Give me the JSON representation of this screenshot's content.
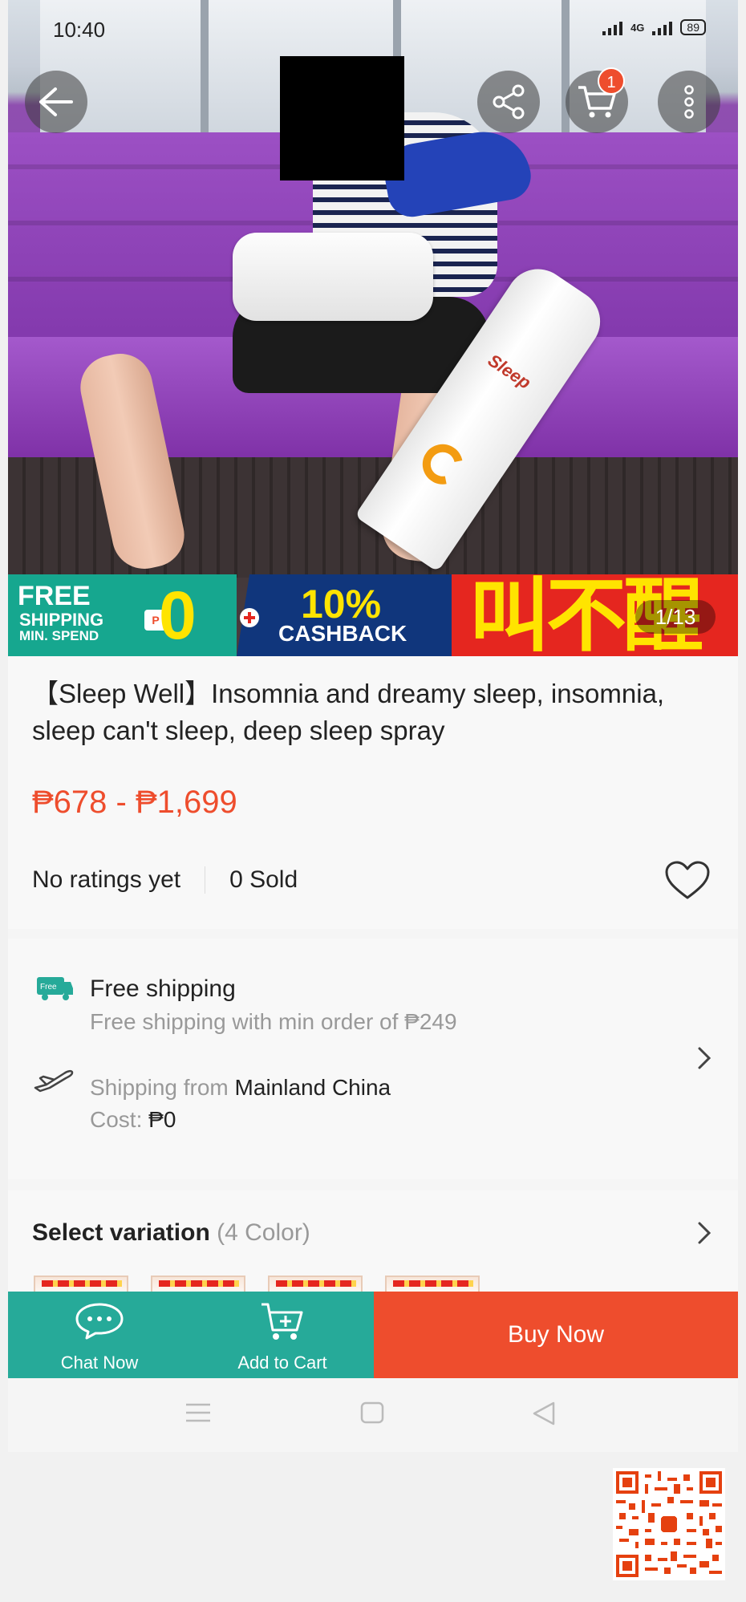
{
  "status_bar": {
    "time": "10:40",
    "network": "4G",
    "battery": "89"
  },
  "top_bar": {
    "back_icon": "arrow-left-icon",
    "share_icon": "share-icon",
    "cart_icon": "cart-icon",
    "cart_badge": "1",
    "more_icon": "more-vertical-icon"
  },
  "gallery": {
    "counter": "1/13",
    "product_brand": "Sleep",
    "promo": {
      "free_line1": "FREE",
      "free_line2": "SHIPPING",
      "free_line3": "MIN. SPEND",
      "free_amount": "0",
      "cashback_pct": "10%",
      "cashback_label": "CASHBACK",
      "chinese_text": "叫不醒"
    }
  },
  "product": {
    "title": "【Sleep Well】Insomnia and dreamy sleep, insomnia, sleep can't sleep, deep sleep spray",
    "price": "₱678 - ₱1,699",
    "rating": "No ratings yet",
    "sold": "0 Sold"
  },
  "shipping": {
    "free_title": "Free shipping",
    "free_sub": "Free shipping with min order of ₱249",
    "from_label": "Shipping from",
    "from_value": "Mainland China",
    "cost_label": "Cost:",
    "cost_value": "₱0",
    "truck_badge": "Free"
  },
  "variation": {
    "label": "Select variation",
    "count": "(4 Color)"
  },
  "actions": {
    "chat": "Chat Now",
    "add_cart": "Add to Cart",
    "buy": "Buy Now"
  },
  "colors": {
    "accent": "#ee4d2d",
    "teal": "#26aa99"
  }
}
